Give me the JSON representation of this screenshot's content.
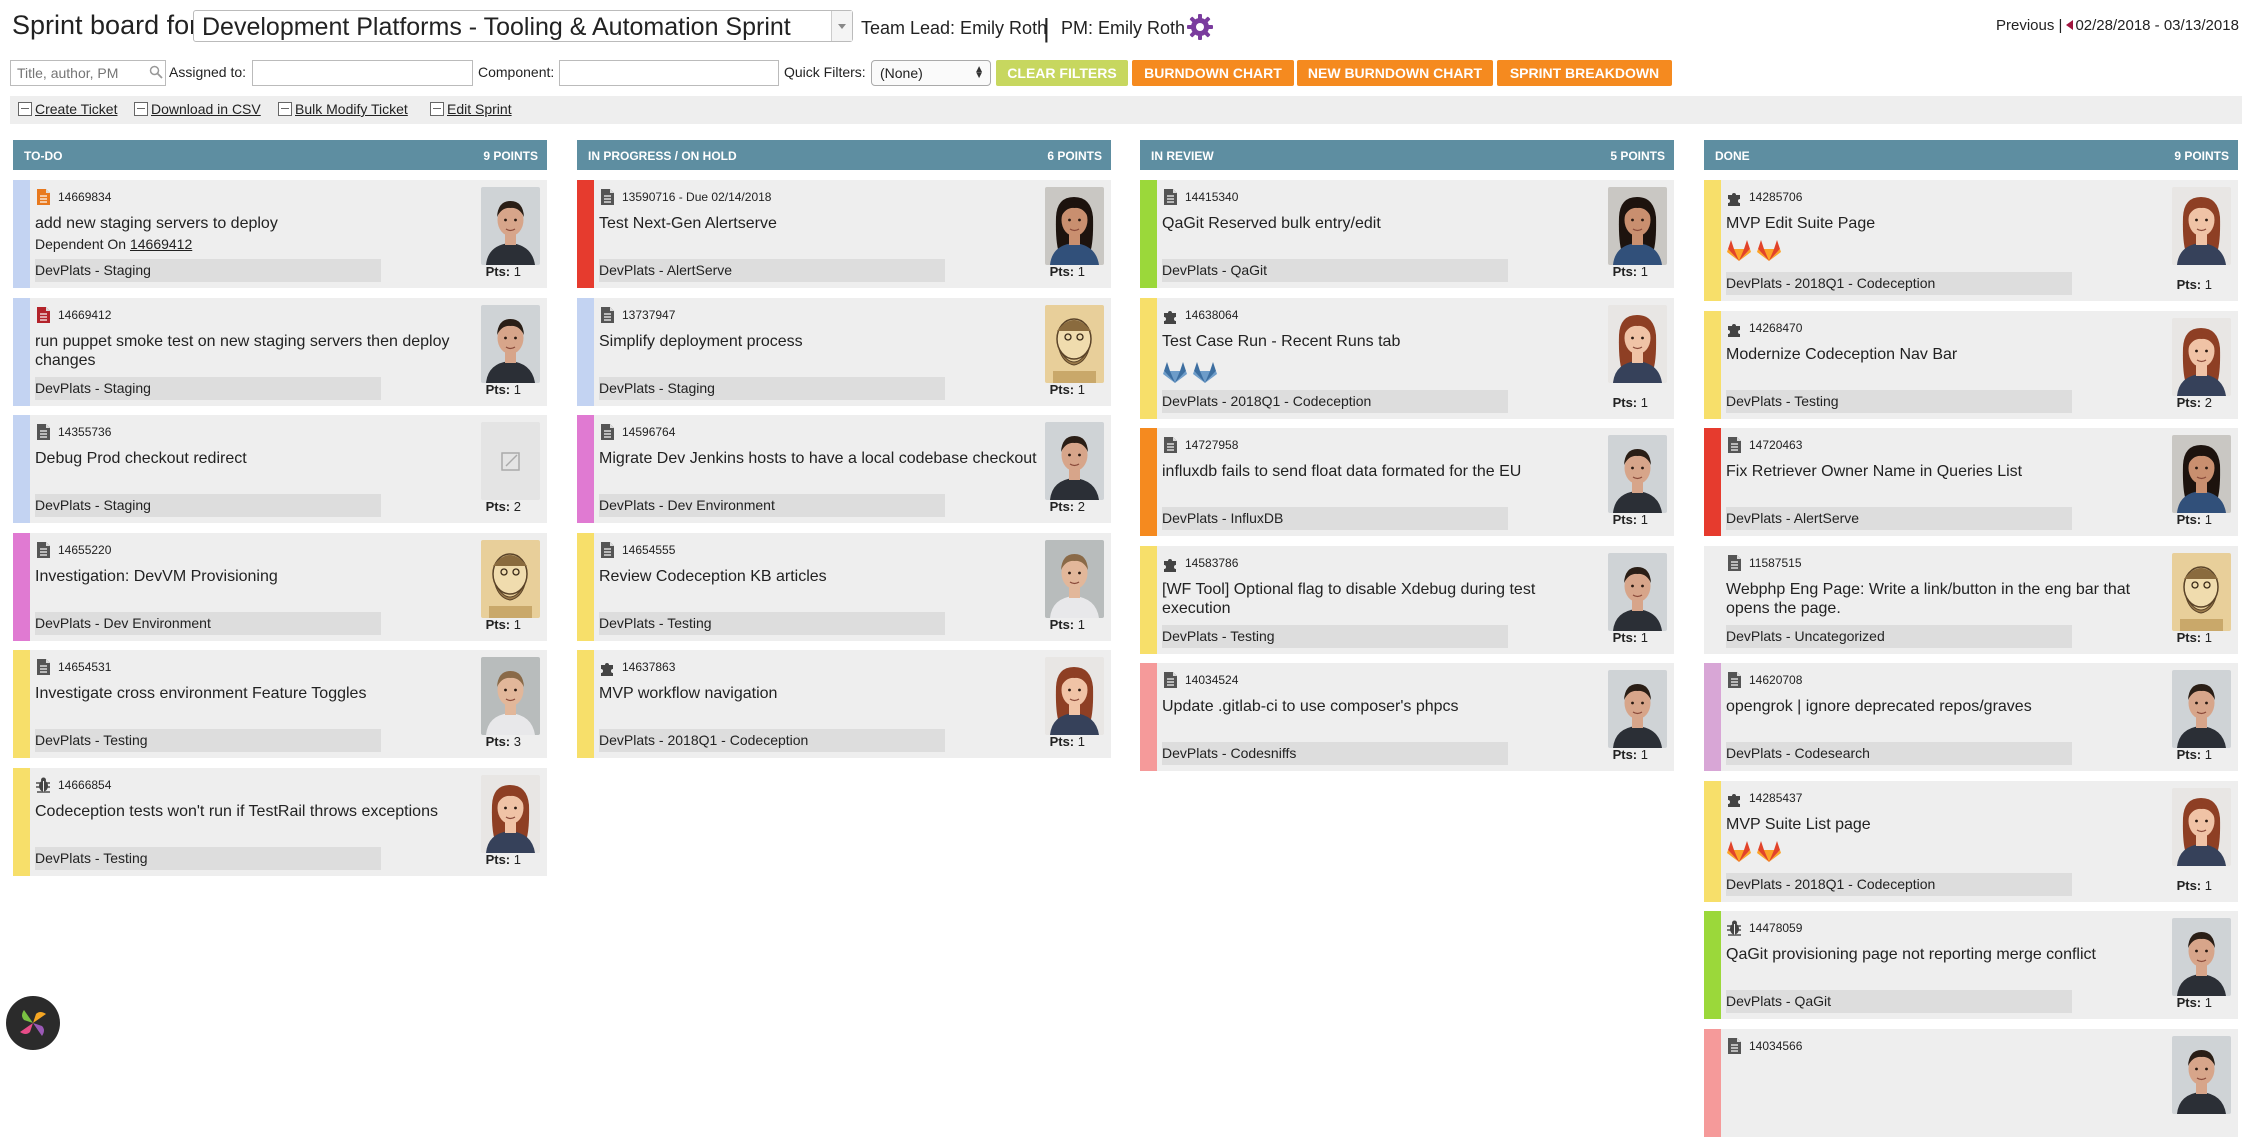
{
  "header": {
    "title_label": "Sprint board for:",
    "sprint_name": "Development Platforms - Tooling & Automation Sprint",
    "team_lead": "Team Lead: Emily Roth",
    "separator": "|",
    "pm": "PM: Emily Roth",
    "previous_label": "Previous |",
    "date_range": "02/28/2018 - 03/13/2018"
  },
  "filters": {
    "search_placeholder": "Title, author, PM",
    "assigned_label": "Assigned to:",
    "component_label": "Component:",
    "quick_filters_label": "Quick Filters:",
    "quick_filter_value": "(None)",
    "clear_filters": "CLEAR FILTERS",
    "burndown": "BURNDOWN CHART",
    "new_burndown": "NEW BURNDOWN CHART",
    "breakdown": "SPRINT BREAKDOWN"
  },
  "toolbar": {
    "create": "Create Ticket",
    "download": "Download in CSV",
    "bulk": "Bulk Modify Ticket",
    "edit": "Edit Sprint"
  },
  "columns": [
    {
      "name": "TO-DO",
      "points": "9 POINTS",
      "cards": [
        {
          "id": "14669834",
          "title": "add new staging servers to deploy",
          "dependent_label": "Dependent On",
          "dependent_id": "14669412",
          "component": "DevPlats - Staging",
          "pts_label": "Pts:",
          "pts": "1",
          "strip": "#c3d3f2",
          "type": "doc-orange",
          "avatar": "man-dark"
        },
        {
          "id": "14669412",
          "title": "run puppet smoke test on new staging servers then deploy changes",
          "component": "DevPlats - Staging",
          "pts_label": "Pts:",
          "pts": "1",
          "strip": "#c3d3f2",
          "type": "doc-red",
          "avatar": "man-dark"
        },
        {
          "id": "14355736",
          "title": "Debug Prod checkout redirect",
          "component": "DevPlats - Staging",
          "pts_label": "Pts:",
          "pts": "2",
          "strip": "#c3d3f2",
          "type": "doc",
          "avatar": "placeholder"
        },
        {
          "id": "14655220",
          "title": "Investigation: DevVM Provisioning",
          "component": "DevPlats - Dev Environment",
          "pts_label": "Pts:",
          "pts": "1",
          "strip": "#e07ad2",
          "type": "doc",
          "avatar": "sketch"
        },
        {
          "id": "14654531",
          "title": "Investigate cross environment Feature Toggles",
          "component": "DevPlats - Testing",
          "pts_label": "Pts:",
          "pts": "3",
          "strip": "#f7df6a",
          "type": "doc",
          "avatar": "man-light"
        },
        {
          "id": "14666854",
          "title": "Codeception tests won't run if TestRail throws exceptions",
          "component": "DevPlats - Testing",
          "pts_label": "Pts:",
          "pts": "1",
          "strip": "#f7df6a",
          "type": "bug",
          "avatar": "woman-red"
        }
      ]
    },
    {
      "name": "IN PROGRESS / ON HOLD",
      "points": "6 POINTS",
      "cards": [
        {
          "id": "13590716 - Due 02/14/2018",
          "title": "Test Next-Gen Alertserve",
          "component": "DevPlats - AlertServe",
          "pts_label": "Pts:",
          "pts": "1",
          "strip": "#e63b2e",
          "type": "doc",
          "avatar": "woman-dark"
        },
        {
          "id": "13737947",
          "title": "Simplify deployment process",
          "component": "DevPlats - Staging",
          "pts_label": "Pts:",
          "pts": "1",
          "strip": "#c3d3f2",
          "type": "doc",
          "avatar": "sketch"
        },
        {
          "id": "14596764",
          "title": "Migrate Dev Jenkins hosts to have a local codebase checkout",
          "component": "DevPlats - Dev Environment",
          "pts_label": "Pts:",
          "pts": "2",
          "strip": "#e07ad2",
          "type": "doc",
          "avatar": "man-dark"
        },
        {
          "id": "14654555",
          "title": "Review Codeception KB articles",
          "component": "DevPlats - Testing",
          "pts_label": "Pts:",
          "pts": "1",
          "strip": "#f7df6a",
          "type": "doc",
          "avatar": "man-light"
        },
        {
          "id": "14637863",
          "title": "MVP workflow navigation",
          "component": "DevPlats - 2018Q1 - Codeception",
          "pts_label": "Pts:",
          "pts": "1",
          "strip": "#f7df6a",
          "type": "puzzle",
          "avatar": "woman-red"
        }
      ]
    },
    {
      "name": "IN REVIEW",
      "points": "5 POINTS",
      "cards": [
        {
          "id": "14415340",
          "title": "QaGit Reserved bulk entry/edit",
          "component": "DevPlats - QaGit",
          "pts_label": "Pts:",
          "pts": "1",
          "strip": "#9bd83a",
          "type": "doc",
          "avatar": "woman-dark"
        },
        {
          "id": "14638064",
          "title": "Test Case Run - Recent Runs tab",
          "component": "DevPlats - 2018Q1 - Codeception",
          "pts_label": "Pts:",
          "pts": "1",
          "strip": "#f7df6a",
          "type": "puzzle",
          "avatar": "woman-red",
          "labels": "blue-fox"
        },
        {
          "id": "14727958",
          "title": "influxdb fails to send float data formated for the EU",
          "component": "DevPlats - InfluxDB",
          "pts_label": "Pts:",
          "pts": "1",
          "strip": "#f58a1f",
          "type": "doc",
          "avatar": "man-dark"
        },
        {
          "id": "14583786",
          "title": "[WF Tool] Optional flag to disable Xdebug during test execution",
          "component": "DevPlats - Testing",
          "pts_label": "Pts:",
          "pts": "1",
          "strip": "#f7df6a",
          "type": "puzzle",
          "avatar": "man-dark"
        },
        {
          "id": "14034524",
          "title": "Update .gitlab-ci to use composer's phpcs",
          "component": "DevPlats - Codesniffs",
          "pts_label": "Pts:",
          "pts": "1",
          "strip": "#f59a9a",
          "type": "doc",
          "avatar": "man-dark"
        }
      ]
    },
    {
      "name": "DONE",
      "points": "9 POINTS",
      "cards": [
        {
          "id": "14285706",
          "title": "MVP Edit Suite Page",
          "component": "DevPlats - 2018Q1 - Codeception",
          "pts_label": "Pts:",
          "pts": "1",
          "strip": "#f7df6a",
          "type": "puzzle",
          "avatar": "woman-red",
          "labels": "orange-fox"
        },
        {
          "id": "14268470",
          "title": "Modernize Codeception Nav Bar",
          "component": "DevPlats - Testing",
          "pts_label": "Pts:",
          "pts": "2",
          "strip": "#f7df6a",
          "type": "puzzle",
          "avatar": "woman-red"
        },
        {
          "id": "14720463",
          "title": "Fix Retriever Owner Name in Queries List",
          "component": "DevPlats - AlertServe",
          "pts_label": "Pts:",
          "pts": "1",
          "strip": "#e63b2e",
          "type": "doc",
          "avatar": "woman-dark"
        },
        {
          "id": "11587515",
          "title": "Webphp Eng Page: Write a link/button in the eng bar that opens the page.",
          "component": "DevPlats - Uncategorized",
          "pts_label": "Pts:",
          "pts": "1",
          "strip": "#eeeeee",
          "type": "doc",
          "avatar": "sketch"
        },
        {
          "id": "14620708",
          "title": "opengrok | ignore deprecated repos/graves",
          "component": "DevPlats - Codesearch",
          "pts_label": "Pts:",
          "pts": "1",
          "strip": "#d8a6d6",
          "type": "doc",
          "avatar": "man-dark"
        },
        {
          "id": "14285437",
          "title": "MVP Suite List page",
          "component": "DevPlats - 2018Q1 - Codeception",
          "pts_label": "Pts:",
          "pts": "1",
          "strip": "#f7df6a",
          "type": "puzzle",
          "avatar": "woman-red",
          "labels": "orange-fox"
        },
        {
          "id": "14478059",
          "title": "QaGit provisioning page not reporting merge conflict",
          "component": "DevPlats - QaGit",
          "pts_label": "Pts:",
          "pts": "1",
          "strip": "#9bd83a",
          "type": "bug",
          "avatar": "man-dark"
        },
        {
          "id": "14034566",
          "title": "",
          "component": "",
          "pts_label": "",
          "pts": "",
          "strip": "#f59a9a",
          "type": "doc",
          "avatar": "man-dark"
        }
      ]
    }
  ]
}
